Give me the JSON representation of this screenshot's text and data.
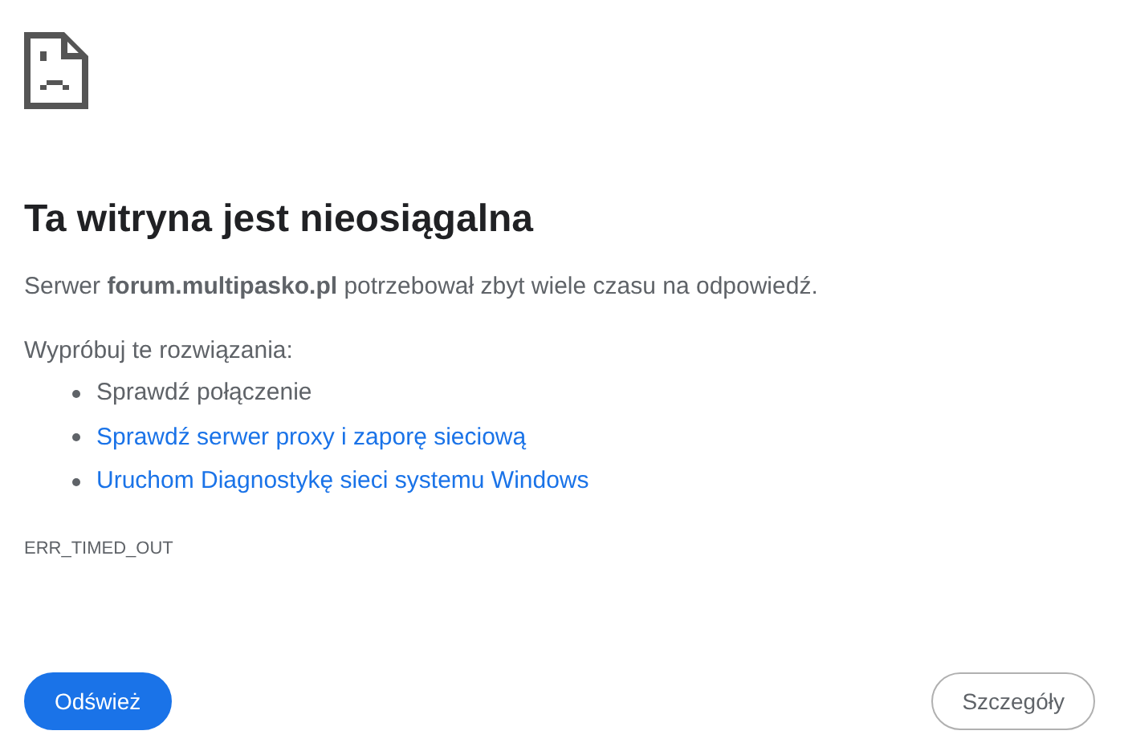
{
  "title": "Ta witryna jest nieosiągalna",
  "message": "Serwer **forum.multipasko.pl** potrzebował zbyt wiele czasu na odpowiedź.",
  "suggestions_heading": "Wypróbuj te rozwiązania:",
  "suggestions": [
    {
      "kind": "text",
      "label": "Sprawdź połączenie"
    },
    {
      "kind": "link",
      "label": "Sprawdź serwer proxy i zaporę sieciową"
    },
    {
      "kind": "link",
      "label": "Uruchom Diagnostykę sieci systemu Windows"
    }
  ],
  "error_code": "ERR_TIMED_OUT",
  "buttons": [
    {
      "kind": "primary",
      "label": "Odśwież"
    },
    {
      "kind": "secondary",
      "label": "Szczegóły"
    }
  ]
}
